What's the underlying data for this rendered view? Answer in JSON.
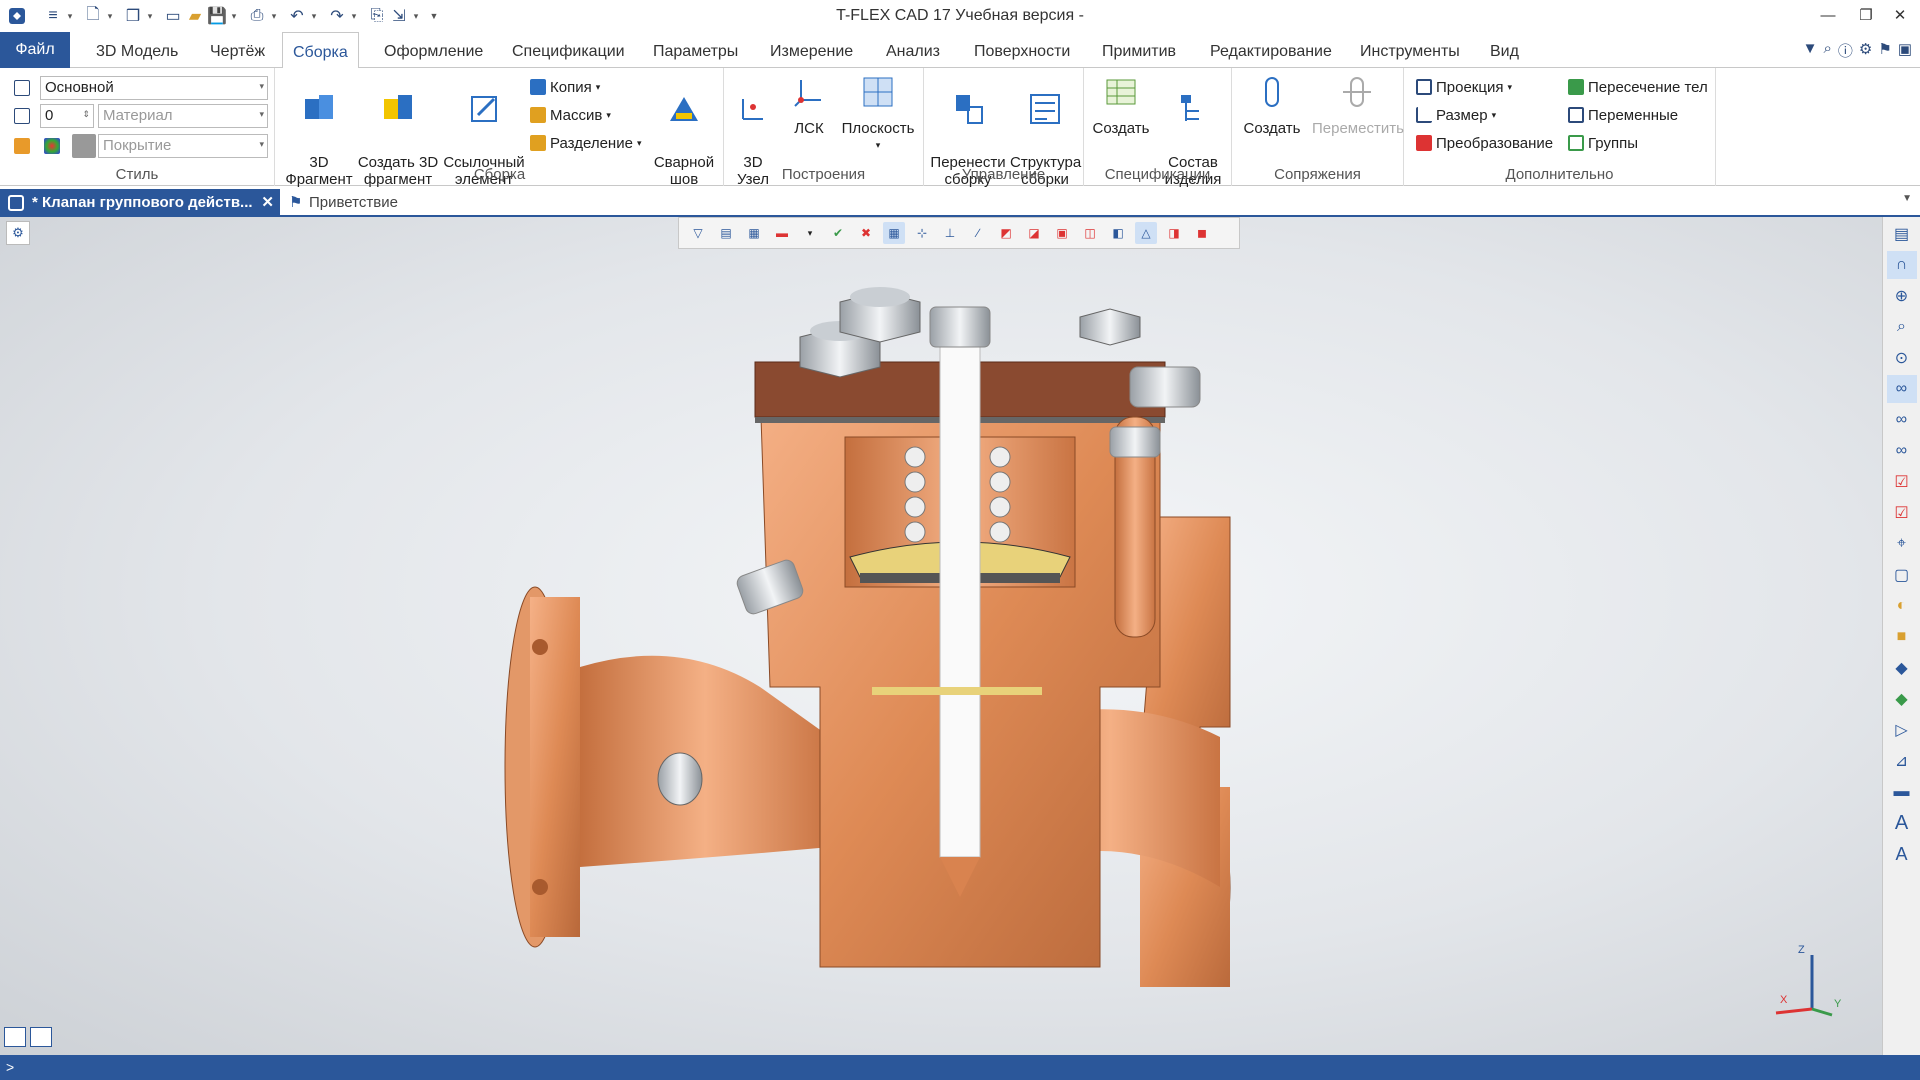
{
  "window": {
    "title": "T-FLEX CAD 17 Учебная версия -"
  },
  "tabs": [
    "3D Модель",
    "Чертёж",
    "Сборка",
    "Оформление",
    "Спецификации",
    "Параметры",
    "Измерение",
    "Анализ",
    "Поверхности",
    "Примитив",
    "Редактирование",
    "Инструменты",
    "Вид"
  ],
  "file_tab": "Файл",
  "active_tab": "Сборка",
  "ribbon": {
    "style": {
      "title": "Стиль",
      "layer_value": "Основной",
      "number_value": "0",
      "material_placeholder": "Материал",
      "coating_placeholder": "Покрытие"
    },
    "assembly": {
      "title": "Сборка",
      "fragment3d": "3D\nФрагмент",
      "create_fragment": "Создать 3D\nфрагмент",
      "ref_element": "Ссылочный\nэлемент",
      "copy": "Копия",
      "array": "Массив",
      "split": "Разделение",
      "weld": "Сварной\nшов"
    },
    "construction": {
      "title": "Построения",
      "node3d": "3D\nУзел",
      "lcs": "ЛСК",
      "plane": "Плоскость"
    },
    "control": {
      "title": "Управление",
      "move_asm": "Перенести\nсборку",
      "asm_struct": "Структура\nсборки"
    },
    "specs": {
      "title": "Спецификации",
      "create": "Создать",
      "composition": "Состав\nизделия"
    },
    "mates": {
      "title": "Сопряжения",
      "create": "Создать",
      "move": "Переместить"
    },
    "extra": {
      "title": "Дополнительно",
      "projection": "Проекция",
      "dimension": "Размер",
      "transform": "Преобразование",
      "intersection": "Пересечение тел",
      "variables": "Переменные",
      "groups": "Группы"
    }
  },
  "documents": {
    "active": "* Клапан группового действ...",
    "other": "Приветствие"
  },
  "axes": {
    "x": "X",
    "y": "Y",
    "z": "Z"
  },
  "status": {
    "prompt": ">"
  },
  "colors": {
    "accent": "#2b579a",
    "copper": "#d9834f"
  }
}
